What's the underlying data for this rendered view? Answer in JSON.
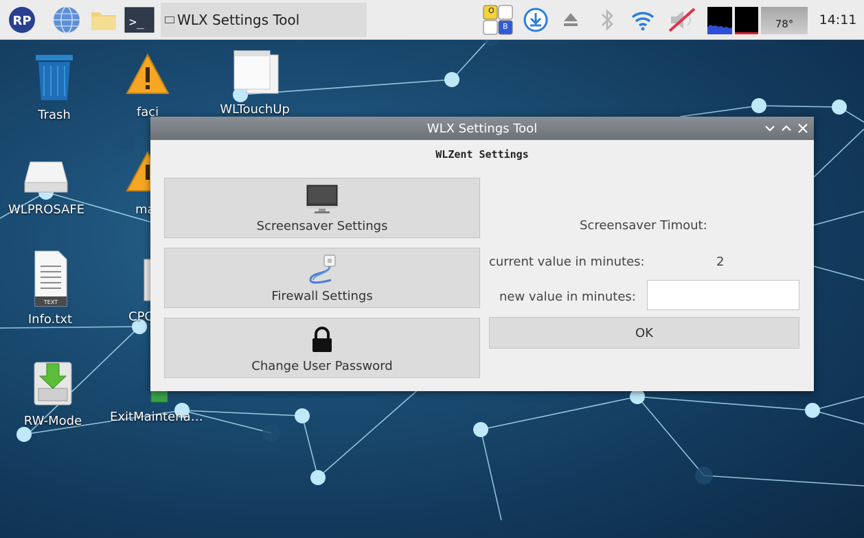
{
  "taskbar": {
    "window_title": "WLX Settings Tool",
    "temperature": "78°",
    "clock": "14:11",
    "keyboard_keys": [
      "O",
      "B"
    ],
    "icons": [
      "raspberry-pi-logo-icon",
      "globe-icon",
      "folder-icon",
      "terminal-icon",
      "download-icon",
      "eject-icon",
      "bluetooth-icon",
      "wifi-icon",
      "volume-muted-icon"
    ]
  },
  "desktop": {
    "icons": [
      {
        "label": "Trash",
        "icon": "trash-icon"
      },
      {
        "label": "faci",
        "icon": "warning-icon"
      },
      {
        "label": "WLTouchUp",
        "icon": "window-icon"
      },
      {
        "label": "WLPROSAFE",
        "icon": "drive-icon"
      },
      {
        "label": "mar",
        "icon": "warning-icon"
      },
      {
        "label": "Info.txt",
        "icon": "text-file-icon"
      },
      {
        "label": "CPC",
        "icon": "computer-icon"
      },
      {
        "label": "RW-Mode",
        "icon": "install-icon"
      },
      {
        "label": "ExitMaintena…",
        "icon": "exit-icon"
      }
    ]
  },
  "dialog": {
    "title": "WLX Settings Tool",
    "heading": "WLZent Settings",
    "buttons": {
      "screensaver": "Screensaver Settings",
      "firewall": "Firewall Settings",
      "password": "Change User Password"
    },
    "screensaver_title": "Screensaver Timout:",
    "current_label": "current value in minutes:",
    "current_value": "2",
    "new_label": "new value in minutes:",
    "new_value": "",
    "ok_label": "OK"
  }
}
